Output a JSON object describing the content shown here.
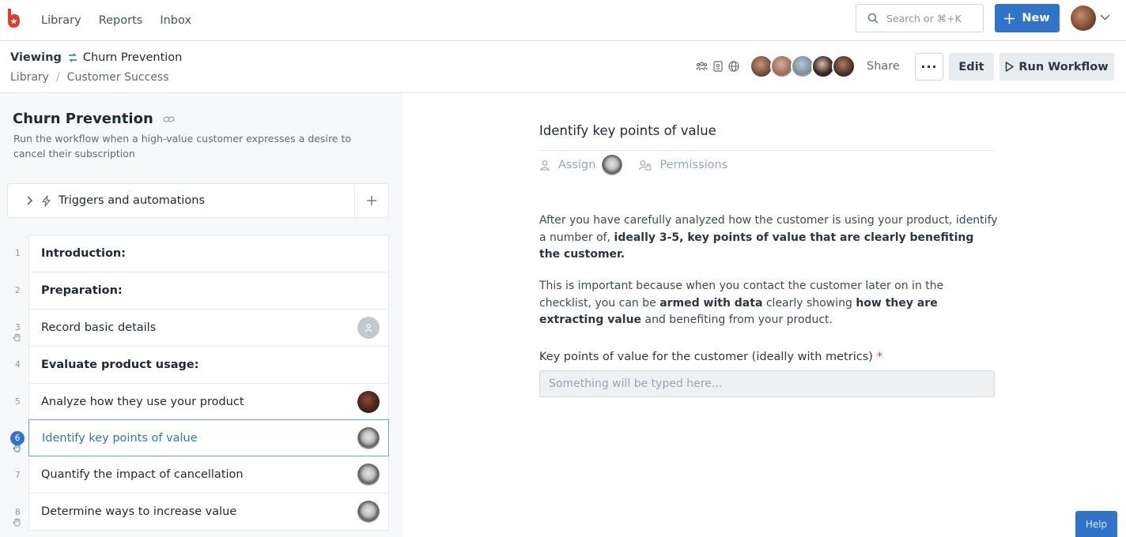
{
  "nav": {
    "items": [
      "Library",
      "Reports",
      "Inbox"
    ]
  },
  "search": {
    "placeholder": "Search or ⌘+K"
  },
  "new_button": {
    "label": "New"
  },
  "header": {
    "viewing_label": "Viewing",
    "workflow_name": "Churn Prevention",
    "breadcrumb": [
      "Library",
      "Customer Success"
    ],
    "share_label": "Share",
    "more_label": "···",
    "edit_label": "Edit",
    "run_label": "Run Workflow"
  },
  "workflow": {
    "title": "Churn Prevention",
    "description": "Run the workflow when a high-value customer expresses a desire to cancel their subscription",
    "triggers_label": "Triggers and automations",
    "tasks": [
      {
        "num": "1",
        "label": "Introduction:",
        "heading": true
      },
      {
        "num": "2",
        "label": "Preparation:",
        "heading": true
      },
      {
        "num": "3",
        "label": "Record basic details",
        "heading": false
      },
      {
        "num": "4",
        "label": "Evaluate product usage:",
        "heading": true
      },
      {
        "num": "5",
        "label": "Analyze how they use your product",
        "heading": false
      },
      {
        "num": "6",
        "label": "Identify key points of value",
        "heading": false,
        "active": true
      },
      {
        "num": "7",
        "label": "Quantify the impact of cancellation",
        "heading": false
      },
      {
        "num": "8",
        "label": "Determine ways to increase value",
        "heading": false
      }
    ]
  },
  "task_detail": {
    "title": "Identify key points of value",
    "assign_label": "Assign",
    "permissions_label": "Permissions",
    "p1_a": "After you have carefully analyzed how the customer is using your product, identify a number of, ",
    "p1_b": "ideally 3-5, key points of value that are clearly benefiting the customer.",
    "p2_a": "This is important because when you contact the customer later on in the checklist, you can be ",
    "p2_b": "armed with data",
    "p2_c": " clearly showing ",
    "p2_d": "how they are extracting value",
    "p2_e": " and benefiting from your product.",
    "field_label": "Key points of value for the customer (ideally with metrics)",
    "required_mark": "*",
    "field_placeholder": "Something will be typed here..."
  },
  "help_label": "Help",
  "colors": {
    "accent": "#2f74c9",
    "required": "#d64545"
  }
}
